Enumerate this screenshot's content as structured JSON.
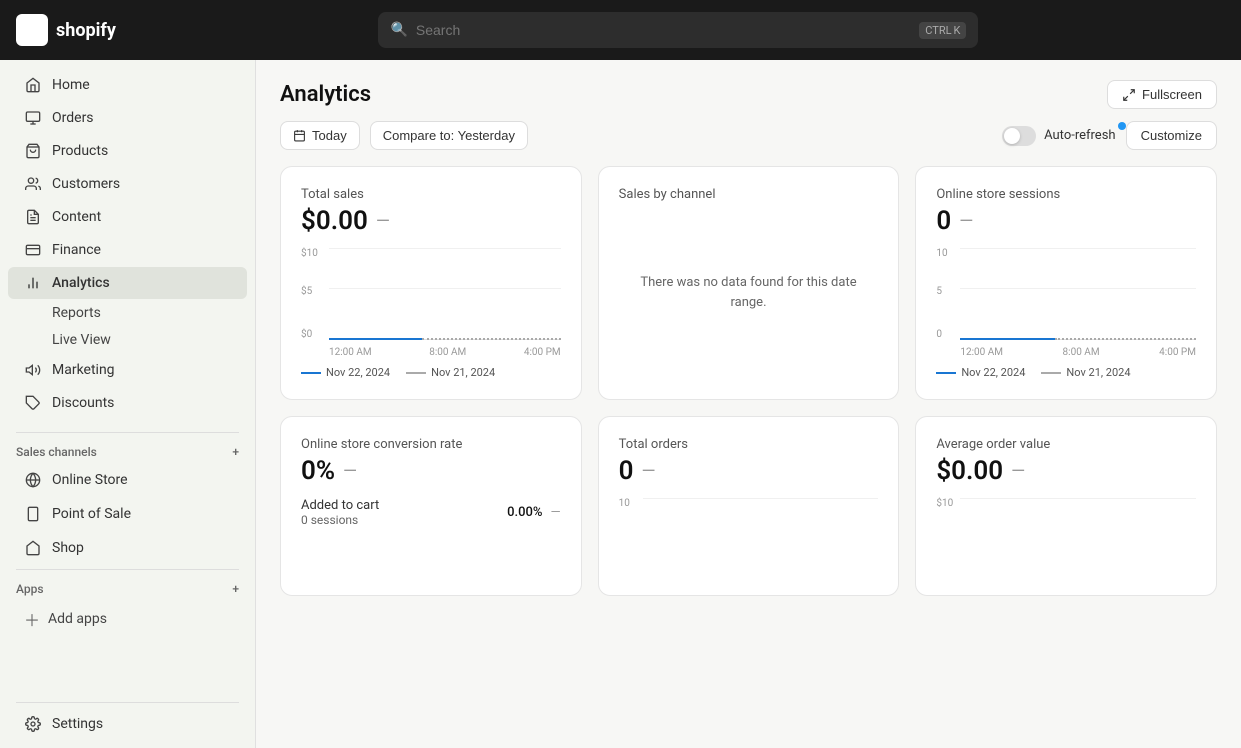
{
  "topbar": {
    "logo_text": "shopify",
    "search_placeholder": "Search",
    "shortcut": [
      "CTRL",
      "K"
    ]
  },
  "sidebar": {
    "items": [
      {
        "id": "home",
        "label": "Home",
        "icon": "home"
      },
      {
        "id": "orders",
        "label": "Orders",
        "icon": "orders"
      },
      {
        "id": "products",
        "label": "Products",
        "icon": "products"
      },
      {
        "id": "customers",
        "label": "Customers",
        "icon": "customers"
      },
      {
        "id": "content",
        "label": "Content",
        "icon": "content"
      },
      {
        "id": "finance",
        "label": "Finance",
        "icon": "finance"
      },
      {
        "id": "analytics",
        "label": "Analytics",
        "icon": "analytics",
        "active": true
      },
      {
        "id": "marketing",
        "label": "Marketing",
        "icon": "marketing"
      },
      {
        "id": "discounts",
        "label": "Discounts",
        "icon": "discounts"
      }
    ],
    "sub_items": [
      {
        "id": "reports",
        "label": "Reports"
      },
      {
        "id": "live-view",
        "label": "Live View"
      }
    ],
    "sales_channels_label": "Sales channels",
    "sales_channels": [
      {
        "id": "online-store",
        "label": "Online Store",
        "icon": "store"
      },
      {
        "id": "point-of-sale",
        "label": "Point of Sale",
        "icon": "pos"
      },
      {
        "id": "shop",
        "label": "Shop",
        "icon": "shop"
      }
    ],
    "apps_label": "Apps",
    "add_apps_label": "Add apps",
    "settings_label": "Settings"
  },
  "main": {
    "title": "Analytics",
    "fullscreen_label": "Fullscreen",
    "toolbar": {
      "today_label": "Today",
      "compare_label": "Compare to: Yesterday",
      "auto_refresh_label": "Auto-refresh",
      "customize_label": "Customize"
    },
    "cards": [
      {
        "id": "total-sales",
        "title": "Total sales",
        "value": "$0.00",
        "dash": "—",
        "chart": {
          "y_labels": [
            "$10",
            "$5",
            "$0"
          ],
          "x_labels": [
            "12:00 AM",
            "8:00 AM",
            "4:00 PM"
          ],
          "legend": [
            {
              "type": "solid",
              "date": "Nov 22, 2024"
            },
            {
              "type": "dotted",
              "date": "Nov 21, 2024"
            }
          ]
        }
      },
      {
        "id": "sales-by-channel",
        "title": "Sales by channel",
        "value": null,
        "no_data": "There was no data found for this date range."
      },
      {
        "id": "online-store-sessions",
        "title": "Online store sessions",
        "value": "0",
        "dash": "—",
        "chart": {
          "y_labels": [
            "10",
            "5",
            "0"
          ],
          "x_labels": [
            "12:00 AM",
            "8:00 AM",
            "4:00 PM"
          ],
          "legend": [
            {
              "type": "solid",
              "date": "Nov 22, 2024"
            },
            {
              "type": "dotted",
              "date": "Nov 21, 2024"
            }
          ]
        }
      },
      {
        "id": "conversion-rate",
        "title": "Online store conversion rate",
        "value": "0%",
        "dash": "—",
        "sub_rows": [
          {
            "label": "Added to cart",
            "sub_label": "0 sessions",
            "value": "0.00%",
            "dash": "—"
          }
        ]
      },
      {
        "id": "total-orders",
        "title": "Total orders",
        "value": "0",
        "dash": "—",
        "chart": {
          "y_labels": [
            "10",
            "",
            ""
          ],
          "x_labels": []
        }
      },
      {
        "id": "average-order-value",
        "title": "Average order value",
        "value": "$0.00",
        "dash": "—",
        "chart": {
          "y_labels": [
            "$10",
            "",
            ""
          ],
          "x_labels": []
        }
      }
    ]
  }
}
